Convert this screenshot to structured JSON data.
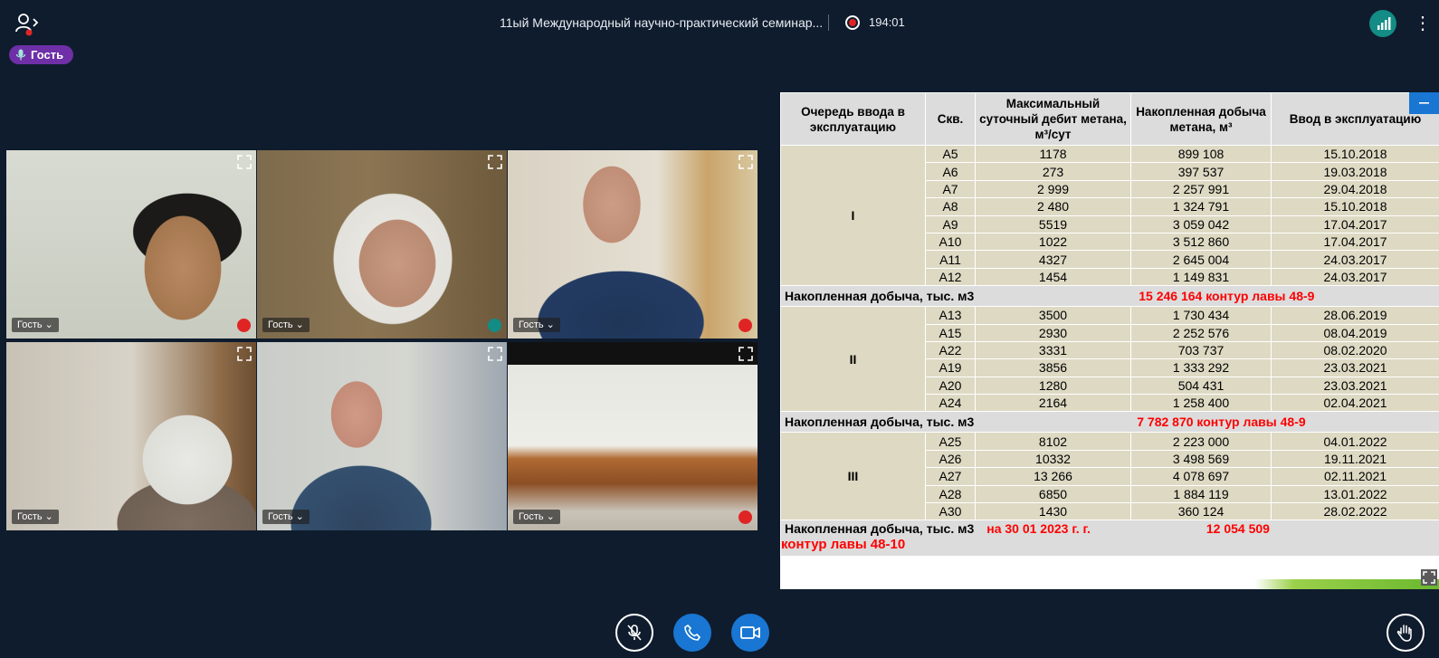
{
  "meeting": {
    "title": "11ый Международный научно-практический семинар...",
    "timer": "194:01",
    "guest_badge": "Гость"
  },
  "tiles": [
    {
      "label": "Гость ⌄",
      "status": "mic-muted",
      "status_color": "#e02424"
    },
    {
      "label": "Гость ⌄",
      "status": "headset",
      "status_color": "#138c85"
    },
    {
      "label": "Гость ⌄",
      "status": "mic-muted",
      "status_color": "#e02424"
    },
    {
      "label": "Гость ⌄",
      "status": "none"
    },
    {
      "label": "Гость ⌄",
      "status": "none",
      "active": true
    },
    {
      "label": "Гость ⌄",
      "status": "mic-muted",
      "status_color": "#e02424"
    }
  ],
  "slide": {
    "headers": [
      "Очередь ввода в эксплуатацию",
      "Скв.",
      "Максимальный суточный дебит метана, м³/сут",
      "Накопленная добыча метана, м³",
      "Ввод в эксплуатацию"
    ],
    "groups": [
      {
        "queue": "I",
        "rows": [
          [
            "A5",
            "1178",
            "899 108",
            "15.10.2018"
          ],
          [
            "A6",
            "273",
            "397 537",
            "19.03.2018"
          ],
          [
            "A7",
            "2 999",
            "2 257 991",
            "29.04.2018"
          ],
          [
            "A8",
            "2 480",
            "1 324 791",
            "15.10.2018"
          ],
          [
            "A9",
            "5519",
            "3 059 042",
            "17.04.2017"
          ],
          [
            "A10",
            "1022",
            "3 512 860",
            "17.04.2017"
          ],
          [
            "A11",
            "4327",
            "2 645 004",
            "24.03.2017"
          ],
          [
            "A12",
            "1454",
            "1 149 831",
            "24.03.2017"
          ]
        ],
        "sum_label": "Накопленная добыча, тыс. м3",
        "sum_value": "15 246 164  контур лавы 48-9"
      },
      {
        "queue": "II",
        "rows": [
          [
            "A13",
            "3500",
            "1 730 434",
            "28.06.2019"
          ],
          [
            "A15",
            "2930",
            "2 252 576",
            "08.04.2019"
          ],
          [
            "A22",
            "3331",
            "703 737",
            "08.02.2020"
          ],
          [
            "A19",
            "3856",
            "1 333 292",
            "23.03.2021"
          ],
          [
            "A20",
            "1280",
            "504 431",
            "23.03.2021"
          ],
          [
            "A24",
            "2164",
            "1 258 400",
            "02.04.2021"
          ]
        ],
        "sum_label": "Накопленная добыча, тыс. м3",
        "sum_value": "7 782 870   контур лавы 48-9"
      },
      {
        "queue": "III",
        "rows": [
          [
            "A25",
            "8102",
            "2 223 000",
            "04.01.2022"
          ],
          [
            "A26",
            "10332",
            "3 498 569",
            "19.11.2021"
          ],
          [
            "A27",
            "13 266",
            "4 078 697",
            "02.11.2021"
          ],
          [
            "A28",
            "6850",
            "1 884 119",
            "13.01.2022"
          ],
          [
            "A30",
            "1430",
            "360 124",
            "28.02.2022"
          ]
        ],
        "sum_label": "Накопленная добыча, тыс. м3",
        "sum_date": "на 30  01 2023 г. г.",
        "sum_value": "12 054 509",
        "sum_note": "контур лавы 48-10"
      }
    ]
  },
  "controls": [
    "mic-off",
    "phone",
    "camera",
    "raise-hand"
  ],
  "colors": {
    "background": "#0f1c2d",
    "accent": "#1976d2",
    "badge": "#6e2fa7",
    "record": "#e02424",
    "muted": "#e02424",
    "signal": "#138c85",
    "table_cell": "#ddd9c3",
    "table_header": "#dcdcdc",
    "highlight": "#ff0000"
  }
}
